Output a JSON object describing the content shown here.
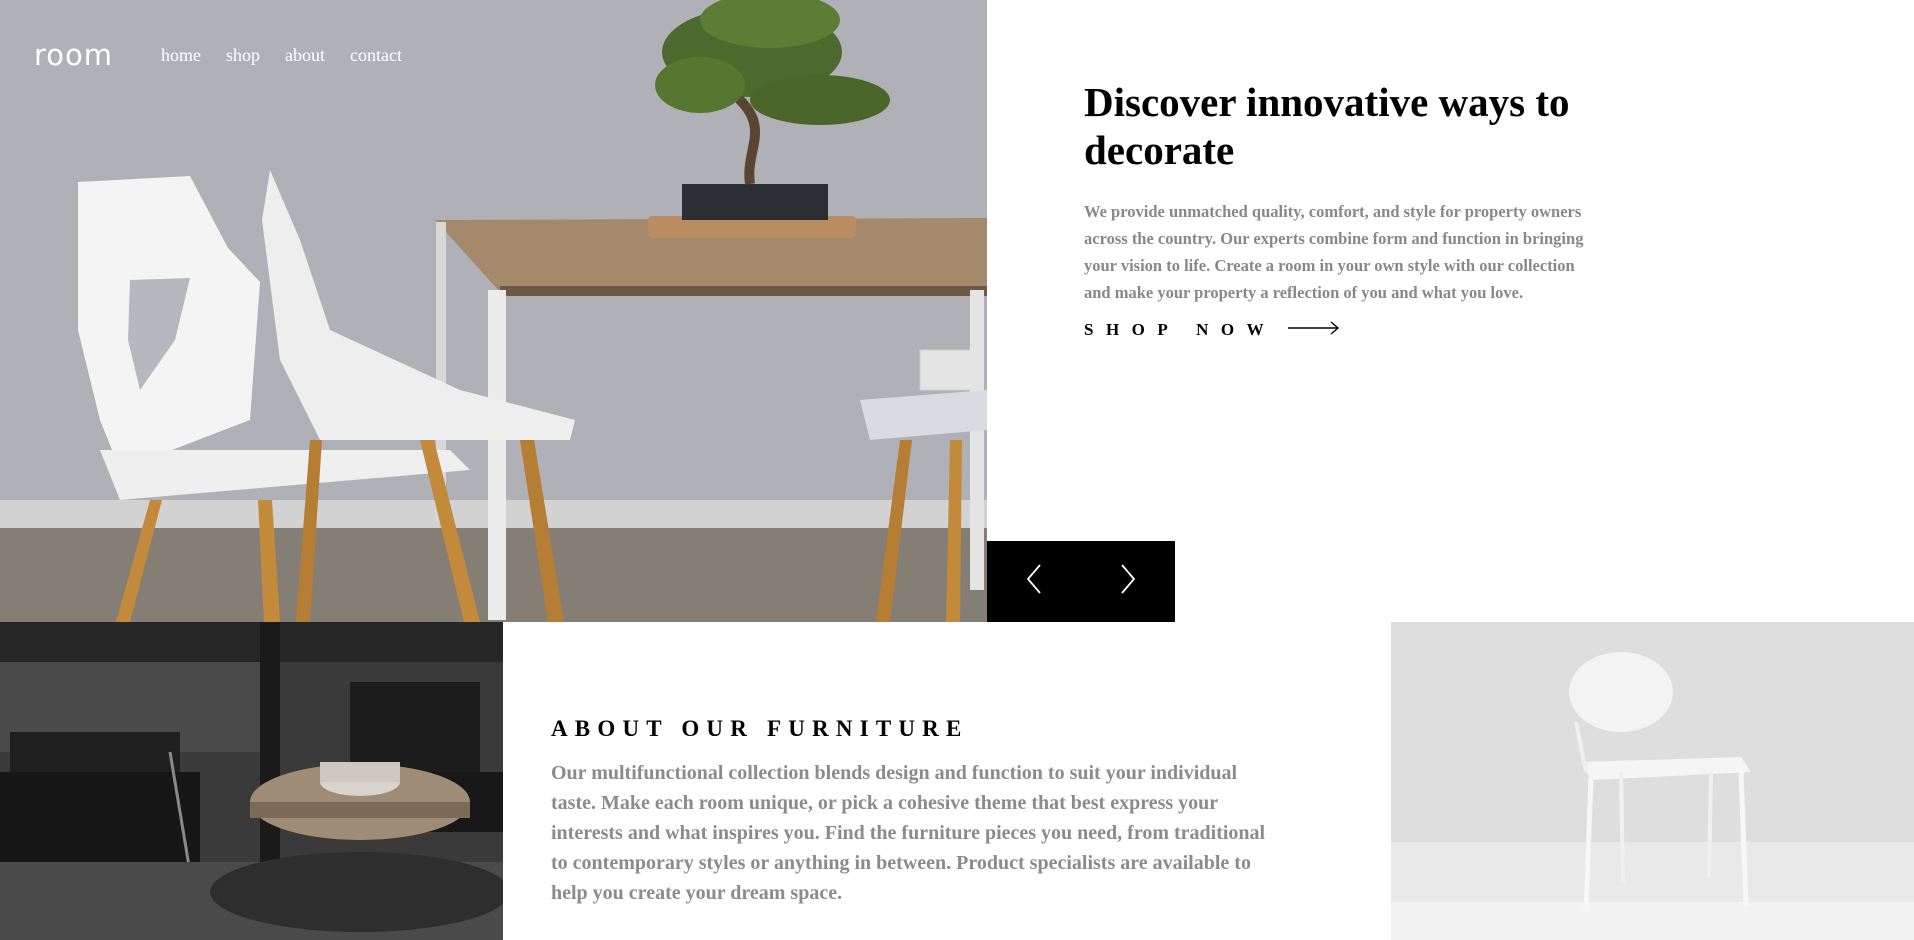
{
  "nav": {
    "logo": "room",
    "links": [
      {
        "label": "home"
      },
      {
        "label": "shop"
      },
      {
        "label": "about"
      },
      {
        "label": "contact"
      }
    ]
  },
  "hero": {
    "title": "Discover innovative ways to decorate",
    "description": "We provide unmatched quality, comfort, and style for property owners across the country. Our experts combine form and function in bringing your vision to life. Create a room in your own style with our collection and make your property a reflection of you and what you love.",
    "cta_label": "SHOP NOW",
    "cta_icon": "arrow-right-icon"
  },
  "slider": {
    "prev_icon": "chevron-left-icon",
    "next_icon": "chevron-right-icon"
  },
  "about": {
    "title": "ABOUT OUR FURNITURE",
    "description": "Our multifunctional collection blends design and function to suit your individual taste. Make each room unique, or pick a cohesive theme that best express your interests and what inspires you. Find the furniture pieces you need, from traditional to contemporary styles or anything in between. Product specialists are available to help you create your dream space."
  },
  "colors": {
    "text_dark": "#000000",
    "text_muted": "#888888",
    "slider_bg": "#000000",
    "nav_text": "#ffffff"
  }
}
